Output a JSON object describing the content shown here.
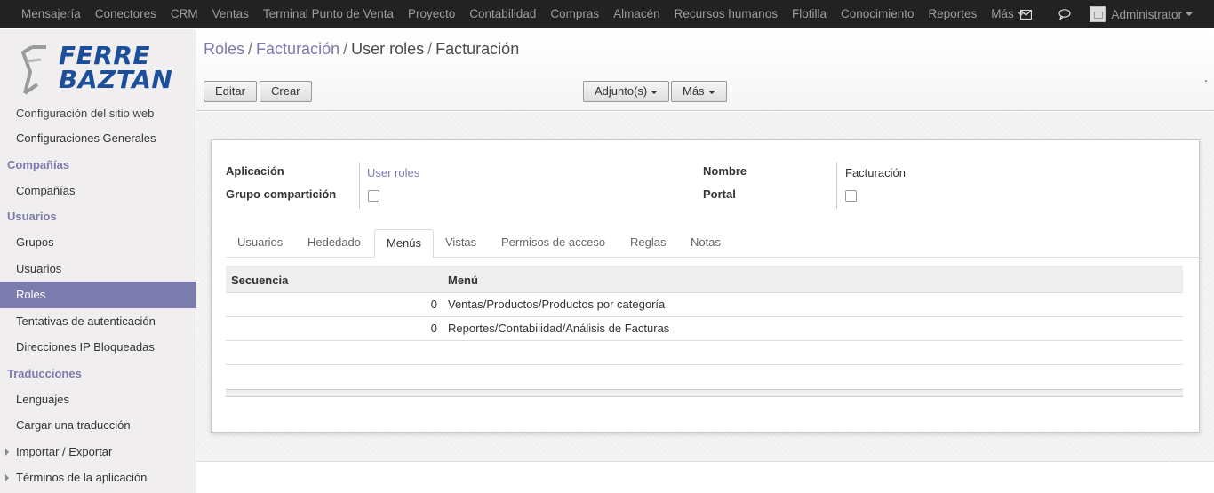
{
  "topbar": {
    "menu": [
      "Mensajería",
      "Conectores",
      "CRM",
      "Ventas",
      "Terminal Punto de Venta",
      "Proyecto",
      "Contabilidad",
      "Compras",
      "Almacén",
      "Recursos humanos",
      "Flotilla",
      "Conocimiento",
      "Reportes"
    ],
    "more": "Más",
    "user": "Administrator",
    "icons": [
      "envelope-icon",
      "chat-icon"
    ]
  },
  "logo": {
    "line1": "FERRE",
    "line2": "BAZTAN"
  },
  "sidebar": {
    "cut_item": "Configuración del sitio web",
    "sections": [
      {
        "header": null,
        "items": [
          {
            "label": "Configuraciones Generales"
          }
        ]
      },
      {
        "header": "Compañías",
        "items": [
          {
            "label": "Compañías"
          }
        ]
      },
      {
        "header": "Usuarios",
        "items": [
          {
            "label": "Grupos"
          },
          {
            "label": "Usuarios"
          },
          {
            "label": "Roles",
            "active": true
          },
          {
            "label": "Tentativas de autenticación"
          },
          {
            "label": "Direcciones IP Bloqueadas"
          }
        ]
      },
      {
        "header": "Traducciones",
        "items": [
          {
            "label": "Lenguajes"
          },
          {
            "label": "Cargar una traducción"
          },
          {
            "label": "Importar / Exportar",
            "expandable": true
          },
          {
            "label": "Términos de la aplicación",
            "expandable": true
          }
        ]
      }
    ]
  },
  "breadcrumb": {
    "items": [
      "Roles",
      "Facturación",
      "User roles"
    ],
    "current": "Facturación",
    "sep": "/"
  },
  "buttons": {
    "edit": "Editar",
    "create": "Crear",
    "attachments": "Adjunto(s)",
    "more": "Más"
  },
  "form": {
    "app_label": "Aplicación",
    "app_value": "User roles",
    "share_label": "Grupo compartición",
    "share_checked": false,
    "name_label": "Nombre",
    "name_value": "Facturación",
    "portal_label": "Portal",
    "portal_checked": false
  },
  "tabs": {
    "items": [
      "Usuarios",
      "Hededado",
      "Menús",
      "Vistas",
      "Permisos de acceso",
      "Reglas",
      "Notas"
    ],
    "active": "Menús"
  },
  "menus_table": {
    "headers": {
      "sequence": "Secuencia",
      "menu": "Menú"
    },
    "rows": [
      {
        "sequence": "0",
        "menu": "Ventas/Productos/Productos por categoría"
      },
      {
        "sequence": "0",
        "menu": "Reportes/Contabilidad/Análisis de Facturas"
      }
    ]
  }
}
